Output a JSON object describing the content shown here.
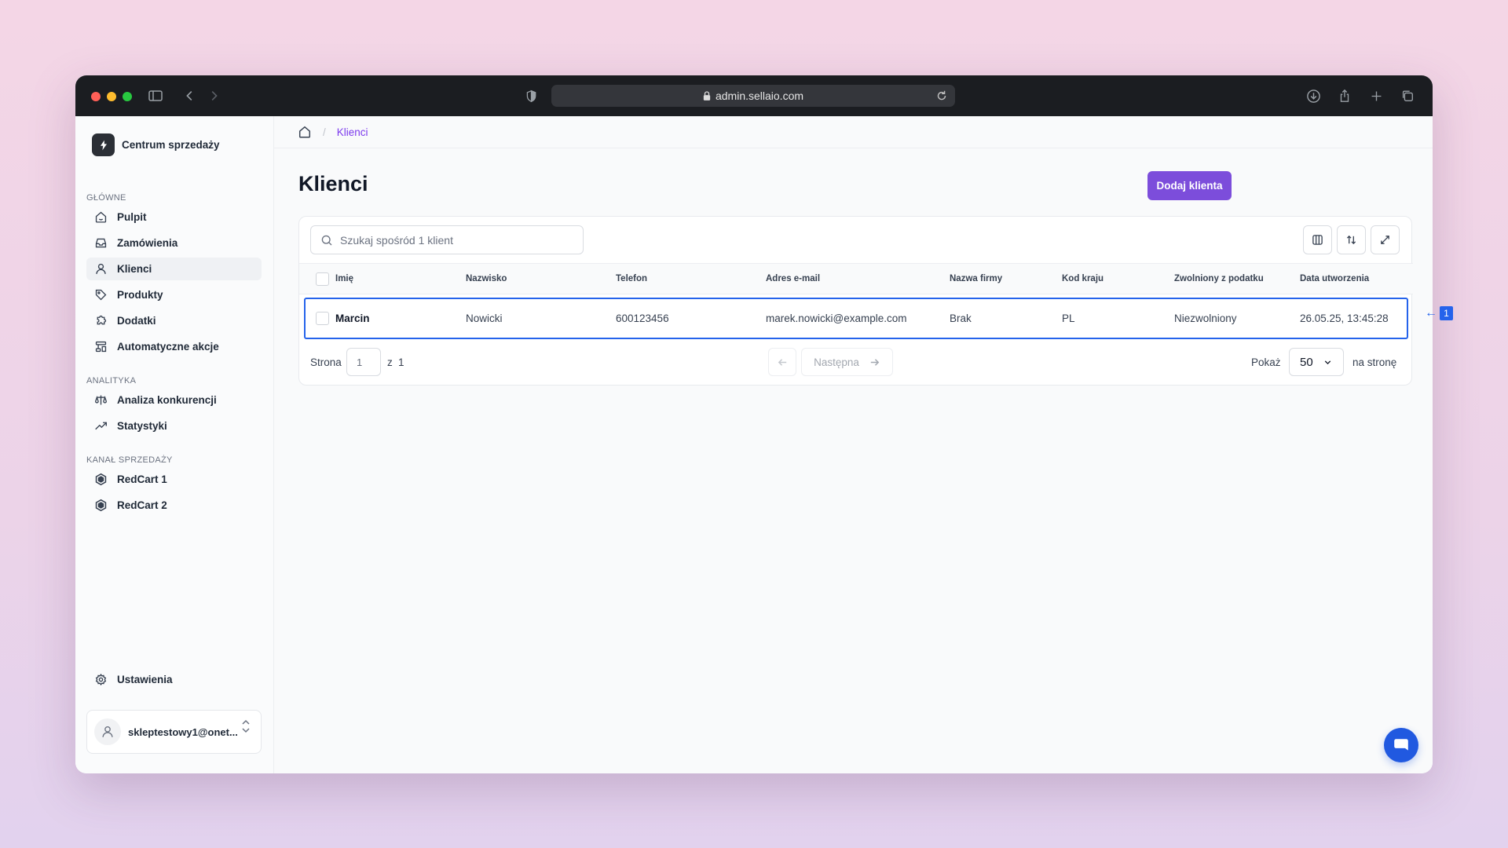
{
  "browser": {
    "url": "admin.sellaio.com",
    "colors": {
      "close": "#ff5f57",
      "minimize": "#febc2e",
      "maximize": "#28c840"
    }
  },
  "sidebar": {
    "brand": "Centrum sprzedaży",
    "sections": [
      {
        "label": "GŁÓWNE",
        "items": [
          {
            "label": "Pulpit",
            "icon": "home-icon"
          },
          {
            "label": "Zamówienia",
            "icon": "inbox-icon"
          },
          {
            "label": "Klienci",
            "icon": "user-icon",
            "active": true
          },
          {
            "label": "Produkty",
            "icon": "tag-icon"
          },
          {
            "label": "Dodatki",
            "icon": "puzzle-icon"
          },
          {
            "label": "Automatyczne akcje",
            "icon": "workflow-icon"
          }
        ]
      },
      {
        "label": "ANALITYKA",
        "items": [
          {
            "label": "Analiza konkurencji",
            "icon": "scale-icon"
          },
          {
            "label": "Statystyki",
            "icon": "trending-up-icon"
          }
        ]
      },
      {
        "label": "KANAŁ SPRZEDAŻY",
        "items": [
          {
            "label": "RedCart 1",
            "icon": "hexagon-icon"
          },
          {
            "label": "RedCart 2",
            "icon": "hexagon-icon"
          }
        ]
      }
    ],
    "settings": "Ustawienia",
    "user_email": "skleptestowy1@onet..."
  },
  "breadcrumb": {
    "current": "Klienci"
  },
  "main": {
    "title": "Klienci",
    "add_button": "Dodaj klienta",
    "search_placeholder": "Szukaj spośród 1 klient",
    "columns": [
      "Imię",
      "Nazwisko",
      "Telefon",
      "Adres e-mail",
      "Nazwa firmy",
      "Kod kraju",
      "Zwolniony z podatku",
      "Data utworzenia"
    ],
    "rows": [
      [
        "Marcin",
        "Nowicki",
        "600123456",
        "marek.nowicki@example.com",
        "Brak",
        "PL",
        "Niezwolniony",
        "26.05.25, 13:45:28"
      ]
    ]
  },
  "pagination": {
    "page_label": "Strona",
    "page_value": "1",
    "of_label": "z",
    "total_pages": "1",
    "next_label": "Następna",
    "show_label": "Pokaż",
    "page_size": "50",
    "per_page_label": "na stronę"
  },
  "marker": {
    "number": "1",
    "arrow": "←"
  },
  "accent": "#7c4ddb"
}
